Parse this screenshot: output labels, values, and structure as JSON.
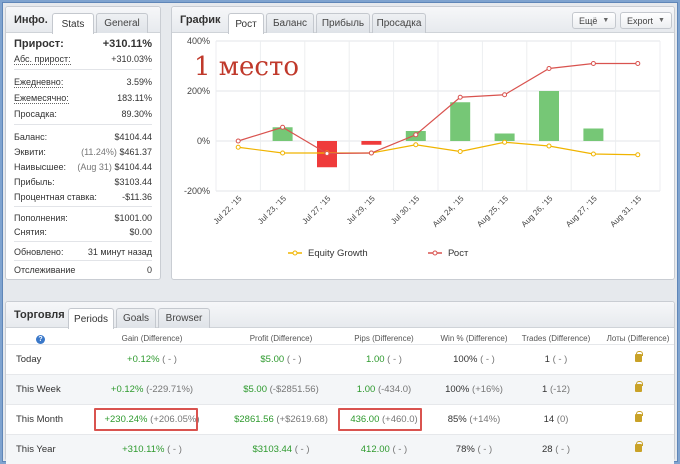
{
  "info": {
    "title": "Инфо.",
    "tabs": [
      "Stats",
      "General"
    ],
    "gain_label": "Прирост:",
    "gain_value": "+310.11%",
    "abs_gain_label": "Абс. прирост:",
    "abs_gain_value": "+310.03%",
    "daily_label": "Ежедневно:",
    "daily_value": "3.59%",
    "monthly_label": "Ежемесячно:",
    "monthly_value": "183.11%",
    "drawdown_label": "Просадка:",
    "drawdown_value": "89.30%",
    "balance_label": "Баланс:",
    "balance_value": "$4104.44",
    "equity_label": "Эквити:",
    "equity_pct": "(11.24%)",
    "equity_value": "$461.37",
    "highest_label": "Наивысшее:",
    "highest_date": "(Aug 31)",
    "highest_value": "$4104.44",
    "profit_label": "Прибыль:",
    "profit_value": "$3103.44",
    "interest_label": "Процентная ставка:",
    "interest_value": "-$11.36",
    "deposits_label": "Пополнения:",
    "deposits_value": "$1001.00",
    "withdrawals_label": "Снятия:",
    "withdrawals_value": "$0.00",
    "updated_label": "Обновлено:",
    "updated_value": "31 минут назад",
    "tracking_label": "Отслеживание",
    "tracking_value": "0"
  },
  "chart_panel": {
    "title": "График",
    "tabs": [
      "Рост",
      "Баланс",
      "Прибыль",
      "Просадка"
    ],
    "more_label": "Ещё",
    "export_label": "Export",
    "annotation": "1 место"
  },
  "chart_data": {
    "type": "bar",
    "categories": [
      "Jul 22, '15",
      "Jul 23, '15",
      "Jul 27, '15",
      "Jul 29, '15",
      "Jul 30, '15",
      "Aug 24, '15",
      "Aug 25, '15",
      "Aug 26, '15",
      "Aug 27, '15",
      "Aug 31, '15"
    ],
    "ylim": [
      -200,
      400
    ],
    "yticks": [
      -200,
      0,
      200,
      400
    ],
    "ytick_labels": [
      "-200%",
      "0%",
      "200%",
      "400%"
    ],
    "bars": [
      0,
      55,
      -105,
      -15,
      40,
      155,
      30,
      200,
      50,
      0
    ],
    "series": [
      {
        "name": "Equity Growth",
        "color": "#f0b400",
        "values": [
          -25,
          -48,
          -48,
          -48,
          -15,
          -42,
          -5,
          -20,
          -52,
          -55
        ]
      },
      {
        "name": "Рост",
        "color": "#d9534f",
        "values": [
          0,
          55,
          -50,
          -48,
          25,
          175,
          185,
          290,
          310,
          310
        ]
      }
    ],
    "bar_positive_color": "#76c776",
    "bar_negative_color": "#ef3b3b",
    "grid": true,
    "legend": "bottom-center"
  },
  "trading": {
    "title": "Торговля",
    "tabs": [
      "Periods",
      "Goals",
      "Browser"
    ],
    "columns": [
      "Gain (Difference)",
      "Profit (Difference)",
      "Pips (Difference)",
      "Win % (Difference)",
      "Trades (Difference)",
      "Лоты (Difference)"
    ],
    "rows": [
      {
        "name": "Today",
        "gain": "+0.12%",
        "gain_diff": "( - )",
        "profit": "$5.00",
        "profit_diff": "( - )",
        "pips": "1.00",
        "pips_diff": "( - )",
        "win": "100%",
        "win_diff": "( - )",
        "trades": "1",
        "trades_diff": "( - )"
      },
      {
        "name": "This Week",
        "gain": "+0.12%",
        "gain_diff": "(-229.71%)",
        "profit": "$5.00",
        "profit_diff": "(-$2851.56)",
        "pips": "1.00",
        "pips_diff": "(-434.0)",
        "win": "100%",
        "win_diff": "(+16%)",
        "trades": "1",
        "trades_diff": "(-12)"
      },
      {
        "name": "This Month",
        "gain": "+230.24%",
        "gain_diff": "(+206.05%)",
        "profit": "$2861.56",
        "profit_diff": "(+$2619.68)",
        "pips": "436.00",
        "pips_diff": "(+460.0)",
        "win": "85%",
        "win_diff": "(+14%)",
        "trades": "14",
        "trades_diff": "(0)"
      },
      {
        "name": "This Year",
        "gain": "+310.11%",
        "gain_diff": "( - )",
        "profit": "$3103.44",
        "profit_diff": "( - )",
        "pips": "412.00",
        "pips_diff": "( - )",
        "win": "78%",
        "win_diff": "( - )",
        "trades": "28",
        "trades_diff": "( - )"
      }
    ]
  }
}
